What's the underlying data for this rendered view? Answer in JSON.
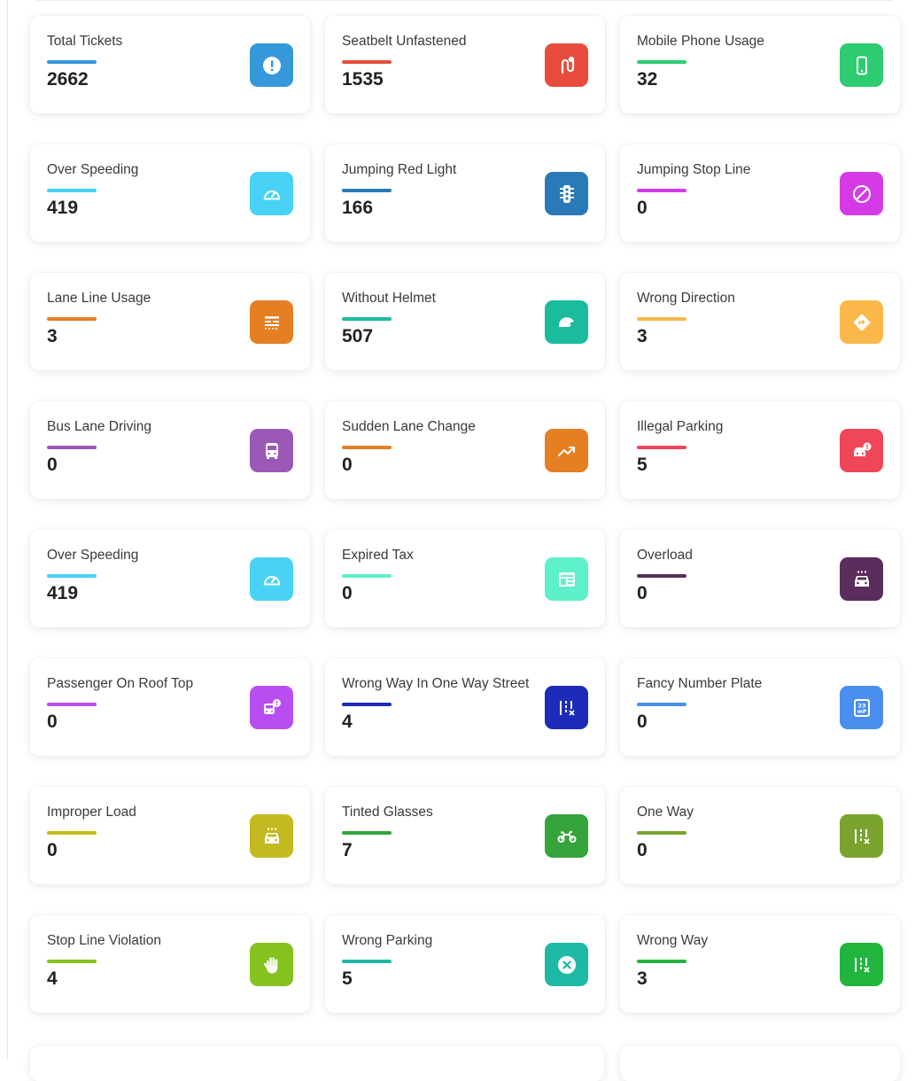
{
  "cards": [
    {
      "title": "Total Tickets",
      "value": "2662",
      "color": "#3498db",
      "icon": "alert-circle-icon"
    },
    {
      "title": "Seatbelt Unfastened",
      "value": "1535",
      "color": "#e74c3c",
      "icon": "seatbelt-icon"
    },
    {
      "title": "Mobile Phone Usage",
      "value": "32",
      "color": "#2ecc71",
      "icon": "mobile-phone-icon"
    },
    {
      "title": "Over Speeding",
      "value": "419",
      "color": "#48d2f5",
      "icon": "speedometer-icon"
    },
    {
      "title": "Jumping Red Light",
      "value": "166",
      "color": "#2a7ab8",
      "icon": "traffic-light-icon"
    },
    {
      "title": "Jumping Stop Line",
      "value": "0",
      "color": "#d63ae6",
      "icon": "block-icon"
    },
    {
      "title": "Lane Line Usage",
      "value": "3",
      "color": "#e67e22",
      "icon": "lane-lines-icon"
    },
    {
      "title": "Without Helmet",
      "value": "507",
      "color": "#1abc9c",
      "icon": "helmet-icon"
    },
    {
      "title": "Wrong Direction",
      "value": "3",
      "color": "#fbb84a",
      "icon": "direction-sign-icon"
    },
    {
      "title": "Bus Lane Driving",
      "value": "0",
      "color": "#9b59b6",
      "icon": "bus-icon"
    },
    {
      "title": "Sudden Lane Change",
      "value": "0",
      "color": "#e67e22",
      "icon": "trending-up-icon"
    },
    {
      "title": "Illegal Parking",
      "value": "5",
      "color": "#ef4658",
      "icon": "car-alert-icon"
    },
    {
      "title": "Over Speeding",
      "value": "419",
      "color": "#48d2f5",
      "icon": "speedometer-icon"
    },
    {
      "title": "Expired Tax",
      "value": "0",
      "color": "#5ef0c9",
      "icon": "tax-document-icon"
    },
    {
      "title": "Overload",
      "value": "0",
      "color": "#5a2d5c",
      "icon": "overload-car-icon"
    },
    {
      "title": "Passenger On Roof Top",
      "value": "0",
      "color": "#b84ef0",
      "icon": "bus-alert-icon"
    },
    {
      "title": "Wrong Way In One Way Street",
      "value": "4",
      "color": "#1d2bb8",
      "icon": "one-way-road-icon"
    },
    {
      "title": "Fancy Number Plate",
      "value": "0",
      "color": "#4a8ef0",
      "icon": "number-plate-icon"
    },
    {
      "title": "Improper Load",
      "value": "0",
      "color": "#c2ba1e",
      "icon": "loaded-car-icon"
    },
    {
      "title": "Tinted Glasses",
      "value": "7",
      "color": "#35a43b",
      "icon": "motorcycle-icon"
    },
    {
      "title": "One Way",
      "value": "0",
      "color": "#7aa32e",
      "icon": "one-way-road-icon"
    },
    {
      "title": "Stop Line Violation",
      "value": "4",
      "color": "#86c21e",
      "icon": "hand-stop-icon"
    },
    {
      "title": "Wrong Parking",
      "value": "5",
      "color": "#1db9a4",
      "icon": "close-circle-icon"
    },
    {
      "title": "Wrong Way",
      "value": "3",
      "color": "#22b53e",
      "icon": "one-way-road-icon"
    }
  ]
}
